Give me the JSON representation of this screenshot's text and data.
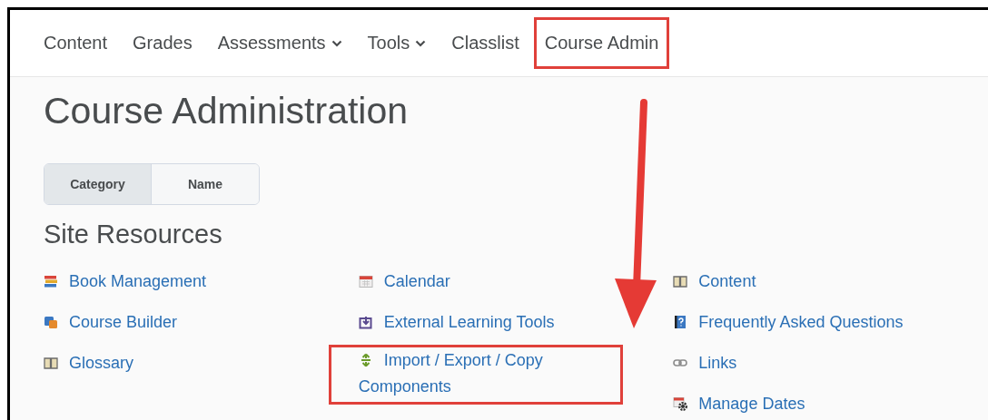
{
  "nav": [
    {
      "label": "Content",
      "has_menu": false,
      "highlighted": false
    },
    {
      "label": "Grades",
      "has_menu": false,
      "highlighted": false
    },
    {
      "label": "Assessments",
      "has_menu": true,
      "highlighted": false
    },
    {
      "label": "Tools",
      "has_menu": true,
      "highlighted": false
    },
    {
      "label": "Classlist",
      "has_menu": false,
      "highlighted": false
    },
    {
      "label": "Course Admin",
      "has_menu": false,
      "highlighted": true
    }
  ],
  "title": "Course Administration",
  "view_toggle": [
    {
      "label": "Category",
      "selected": true
    },
    {
      "label": "Name",
      "selected": false
    }
  ],
  "section": {
    "title": "Site Resources",
    "columns": [
      {
        "items": [
          {
            "label": "Book Management",
            "highlighted": false
          },
          {
            "label": "Course Builder",
            "highlighted": false
          },
          {
            "label": "Glossary",
            "highlighted": false
          }
        ]
      },
      {
        "items": [
          {
            "label": "Calendar",
            "highlighted": false
          },
          {
            "label": "External Learning Tools",
            "highlighted": false
          },
          {
            "label": "Import / Export / Copy Components",
            "highlighted": true
          }
        ]
      },
      {
        "items": [
          {
            "label": "Content",
            "highlighted": false
          },
          {
            "label": "Frequently Asked Questions",
            "highlighted": false
          },
          {
            "label": "Links",
            "highlighted": false
          },
          {
            "label": "Manage Dates",
            "highlighted": false
          }
        ]
      }
    ]
  },
  "callout_arrow": true
}
